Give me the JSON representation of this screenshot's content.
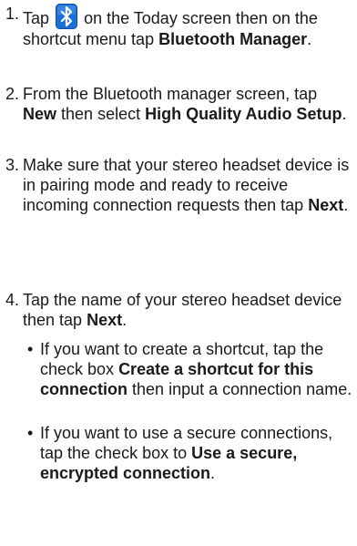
{
  "steps": [
    {
      "num": "1.",
      "pre": "Tap",
      "icon": "bluetooth-icon",
      "mid": "on the Today screen then on the shortcut menu tap",
      "bold": "Bluetooth Manager",
      "post": "."
    },
    {
      "num": "2.",
      "pre": "From the Bluetooth manager screen, tap",
      "bold1": "New",
      "mid": "then select",
      "bold2": "High Quality Audio Setup",
      "post": "."
    },
    {
      "num": "3.",
      "pre": "Make sure that your stereo headset device is in pairing mode and ready to receive incoming connection requests then tap",
      "bold": "Next",
      "post": "."
    },
    {
      "num": "4.",
      "pre": "Tap the name of your stereo headset device then tap",
      "bold": "Next",
      "post": "."
    }
  ],
  "bullets": [
    {
      "dot": "•",
      "pre": "If you want to create a shortcut, tap the check box",
      "bold": "Create a shortcut for this connection",
      "post": "then input a connection name."
    },
    {
      "dot": "•",
      "pre": "If you want to use a secure connections, tap the check box to",
      "bold": "Use a secure, encrypted connection",
      "post": "."
    }
  ],
  "colors": {
    "icon_bg": "#1b6fd6",
    "icon_fg": "#ffffff",
    "text": "#1a1a1a"
  }
}
